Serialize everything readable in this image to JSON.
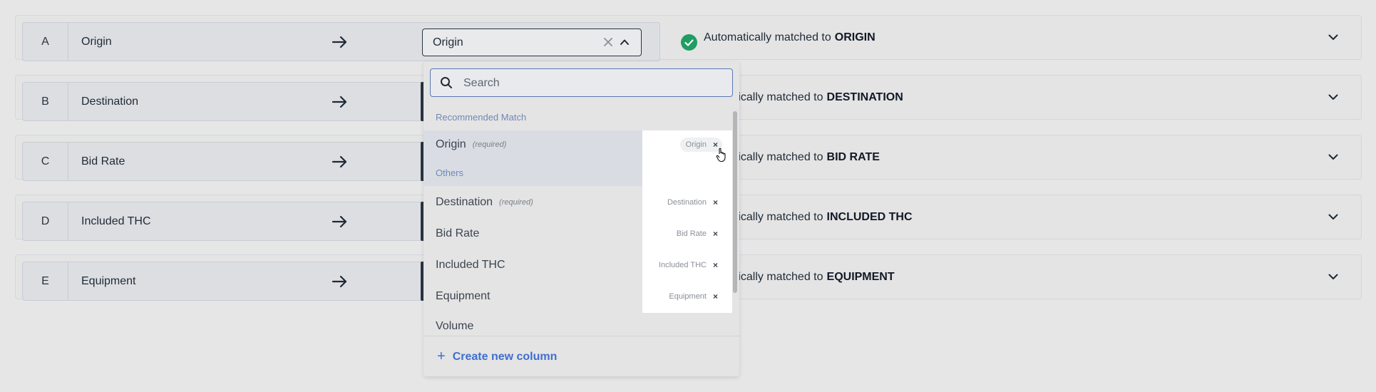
{
  "rows": [
    {
      "letter": "A",
      "name": "Origin",
      "match_prefix": "Automatically matched to",
      "match_target": "ORIGIN"
    },
    {
      "letter": "B",
      "name": "Destination",
      "match_prefix": "atically matched to",
      "match_target": "DESTINATION"
    },
    {
      "letter": "C",
      "name": "Bid Rate",
      "match_prefix": "atically matched to",
      "match_target": "BID RATE"
    },
    {
      "letter": "D",
      "name": "Included THC",
      "match_prefix": "atically matched to",
      "match_target": "INCLUDED THC"
    },
    {
      "letter": "E",
      "name": "Equipment",
      "match_prefix": "atically matched to",
      "match_target": "EQUIPMENT"
    }
  ],
  "select": {
    "value": "Origin"
  },
  "dropdown": {
    "search_placeholder": "Search",
    "recommended_heading": "Recommended Match",
    "others_heading": "Others",
    "options": [
      {
        "label": "Origin",
        "required": "(required)",
        "tag": "Origin"
      },
      {
        "label": "Destination",
        "required": "(required)",
        "tag": "Destination"
      },
      {
        "label": "Bid Rate",
        "required": "",
        "tag": "Bid Rate"
      },
      {
        "label": "Included THC",
        "required": "",
        "tag": "Included THC"
      },
      {
        "label": "Equipment",
        "required": "",
        "tag": "Equipment"
      },
      {
        "label": "Volume",
        "required": "",
        "tag": ""
      }
    ],
    "tag_remove": "×",
    "create_plus": "+",
    "create_label": "Create new column"
  },
  "colors": {
    "accent": "#3f6ed0",
    "success": "#1f9d63",
    "heading": "#7088b8"
  }
}
